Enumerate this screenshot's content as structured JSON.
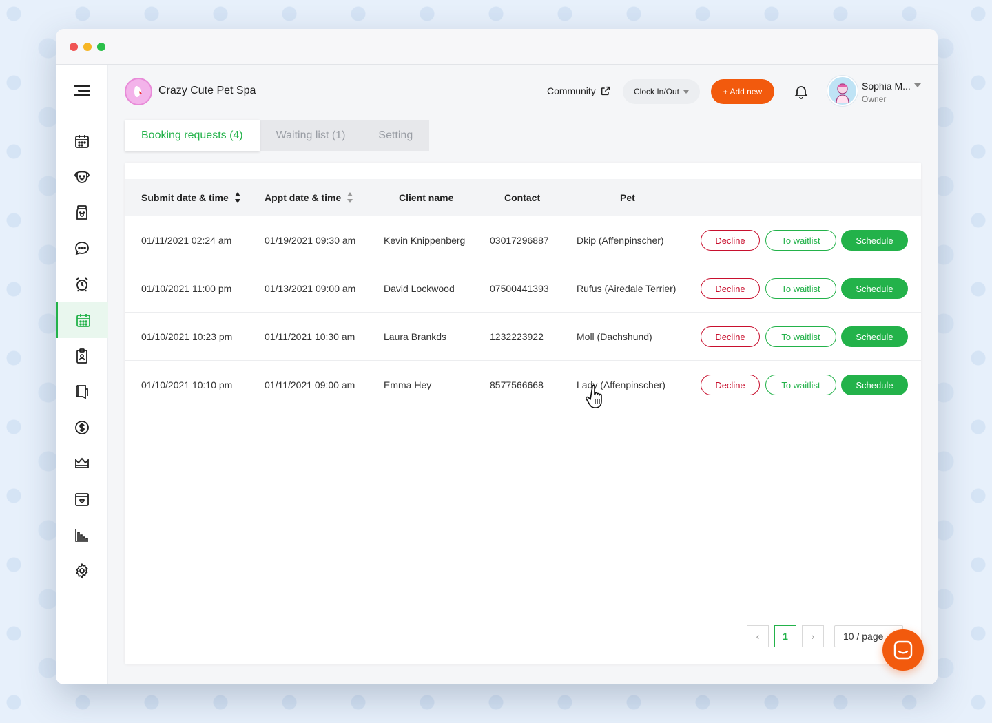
{
  "brand": {
    "name": "Crazy Cute Pet Spa",
    "logo_icon": "pet-spa-logo"
  },
  "header": {
    "community_label": "Community",
    "clock_label": "Clock In/Out",
    "add_new_label": "+ Add new",
    "user_name": "Sophia M...",
    "user_role": "Owner"
  },
  "sidebar": {
    "items": [
      {
        "icon": "calendar-icon"
      },
      {
        "icon": "dog-icon"
      },
      {
        "icon": "pet-food-icon"
      },
      {
        "icon": "chat-icon"
      },
      {
        "icon": "alarm-clock-icon"
      },
      {
        "icon": "booking-calendar-icon",
        "active": true
      },
      {
        "icon": "clipboard-icon"
      },
      {
        "icon": "notebook-icon"
      },
      {
        "icon": "dollar-icon"
      },
      {
        "icon": "crown-icon"
      },
      {
        "icon": "wallet-icon"
      },
      {
        "icon": "bar-chart-icon"
      },
      {
        "icon": "gear-icon"
      }
    ]
  },
  "tabs": [
    {
      "label": "Booking requests (4)",
      "active": true
    },
    {
      "label": "Waiting list (1)"
    },
    {
      "label": "Setting"
    }
  ],
  "table": {
    "columns": [
      "Submit date & time",
      "Appt date & time",
      "Client name",
      "Contact",
      "Pet"
    ],
    "rows": [
      {
        "submit": "01/11/2021 02:24 am",
        "appt": "01/19/2021 09:30 am",
        "client": "Kevin Knippenberg",
        "contact": "03017296887",
        "pet": "Dkip (Affenpinscher)"
      },
      {
        "submit": "01/10/2021 11:00 pm",
        "appt": "01/13/2021 09:00 am",
        "client": "David Lockwood",
        "contact": "07500441393",
        "pet": "Rufus (Airedale Terrier)"
      },
      {
        "submit": "01/10/2021 10:23 pm",
        "appt": "01/11/2021 10:30 am",
        "client": "Laura Brankds",
        "contact": "1232223922",
        "pet": "Moll (Dachshund)"
      },
      {
        "submit": "01/10/2021 10:10 pm",
        "appt": "01/11/2021 09:00 am",
        "client": "Emma Hey",
        "contact": "8577566668",
        "pet": "Lady (Affenpinscher)"
      }
    ],
    "actions": {
      "decline": "Decline",
      "waitlist": "To waitlist",
      "schedule": "Schedule"
    }
  },
  "pagination": {
    "prev": "‹",
    "current": "1",
    "next": "›",
    "page_size": "10 / page"
  },
  "colors": {
    "accent_green": "#23b24a",
    "accent_orange": "#f25a0d",
    "decline_red": "#c8102e"
  }
}
